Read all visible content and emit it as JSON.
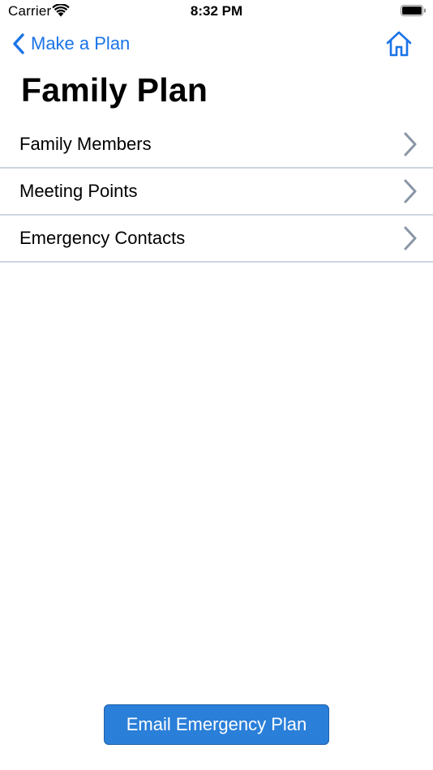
{
  "status_bar": {
    "carrier": "Carrier",
    "time": "8:32 PM",
    "wifi_icon": "wifi-icon",
    "battery_icon": "battery-icon"
  },
  "nav": {
    "back_label": "Make a Plan",
    "back_icon": "chevron-left-icon",
    "home_icon": "home-icon"
  },
  "page": {
    "title": "Family Plan"
  },
  "list": {
    "items": [
      {
        "label": "Family Members"
      },
      {
        "label": "Meeting Points"
      },
      {
        "label": "Emergency Contacts"
      }
    ]
  },
  "footer": {
    "email_button_label": "Email Emergency Plan"
  },
  "colors": {
    "accent": "#1a73e8",
    "button_bg": "#2a7fd9",
    "divider": "#ccd6e0",
    "chevron": "#8a96a6"
  }
}
